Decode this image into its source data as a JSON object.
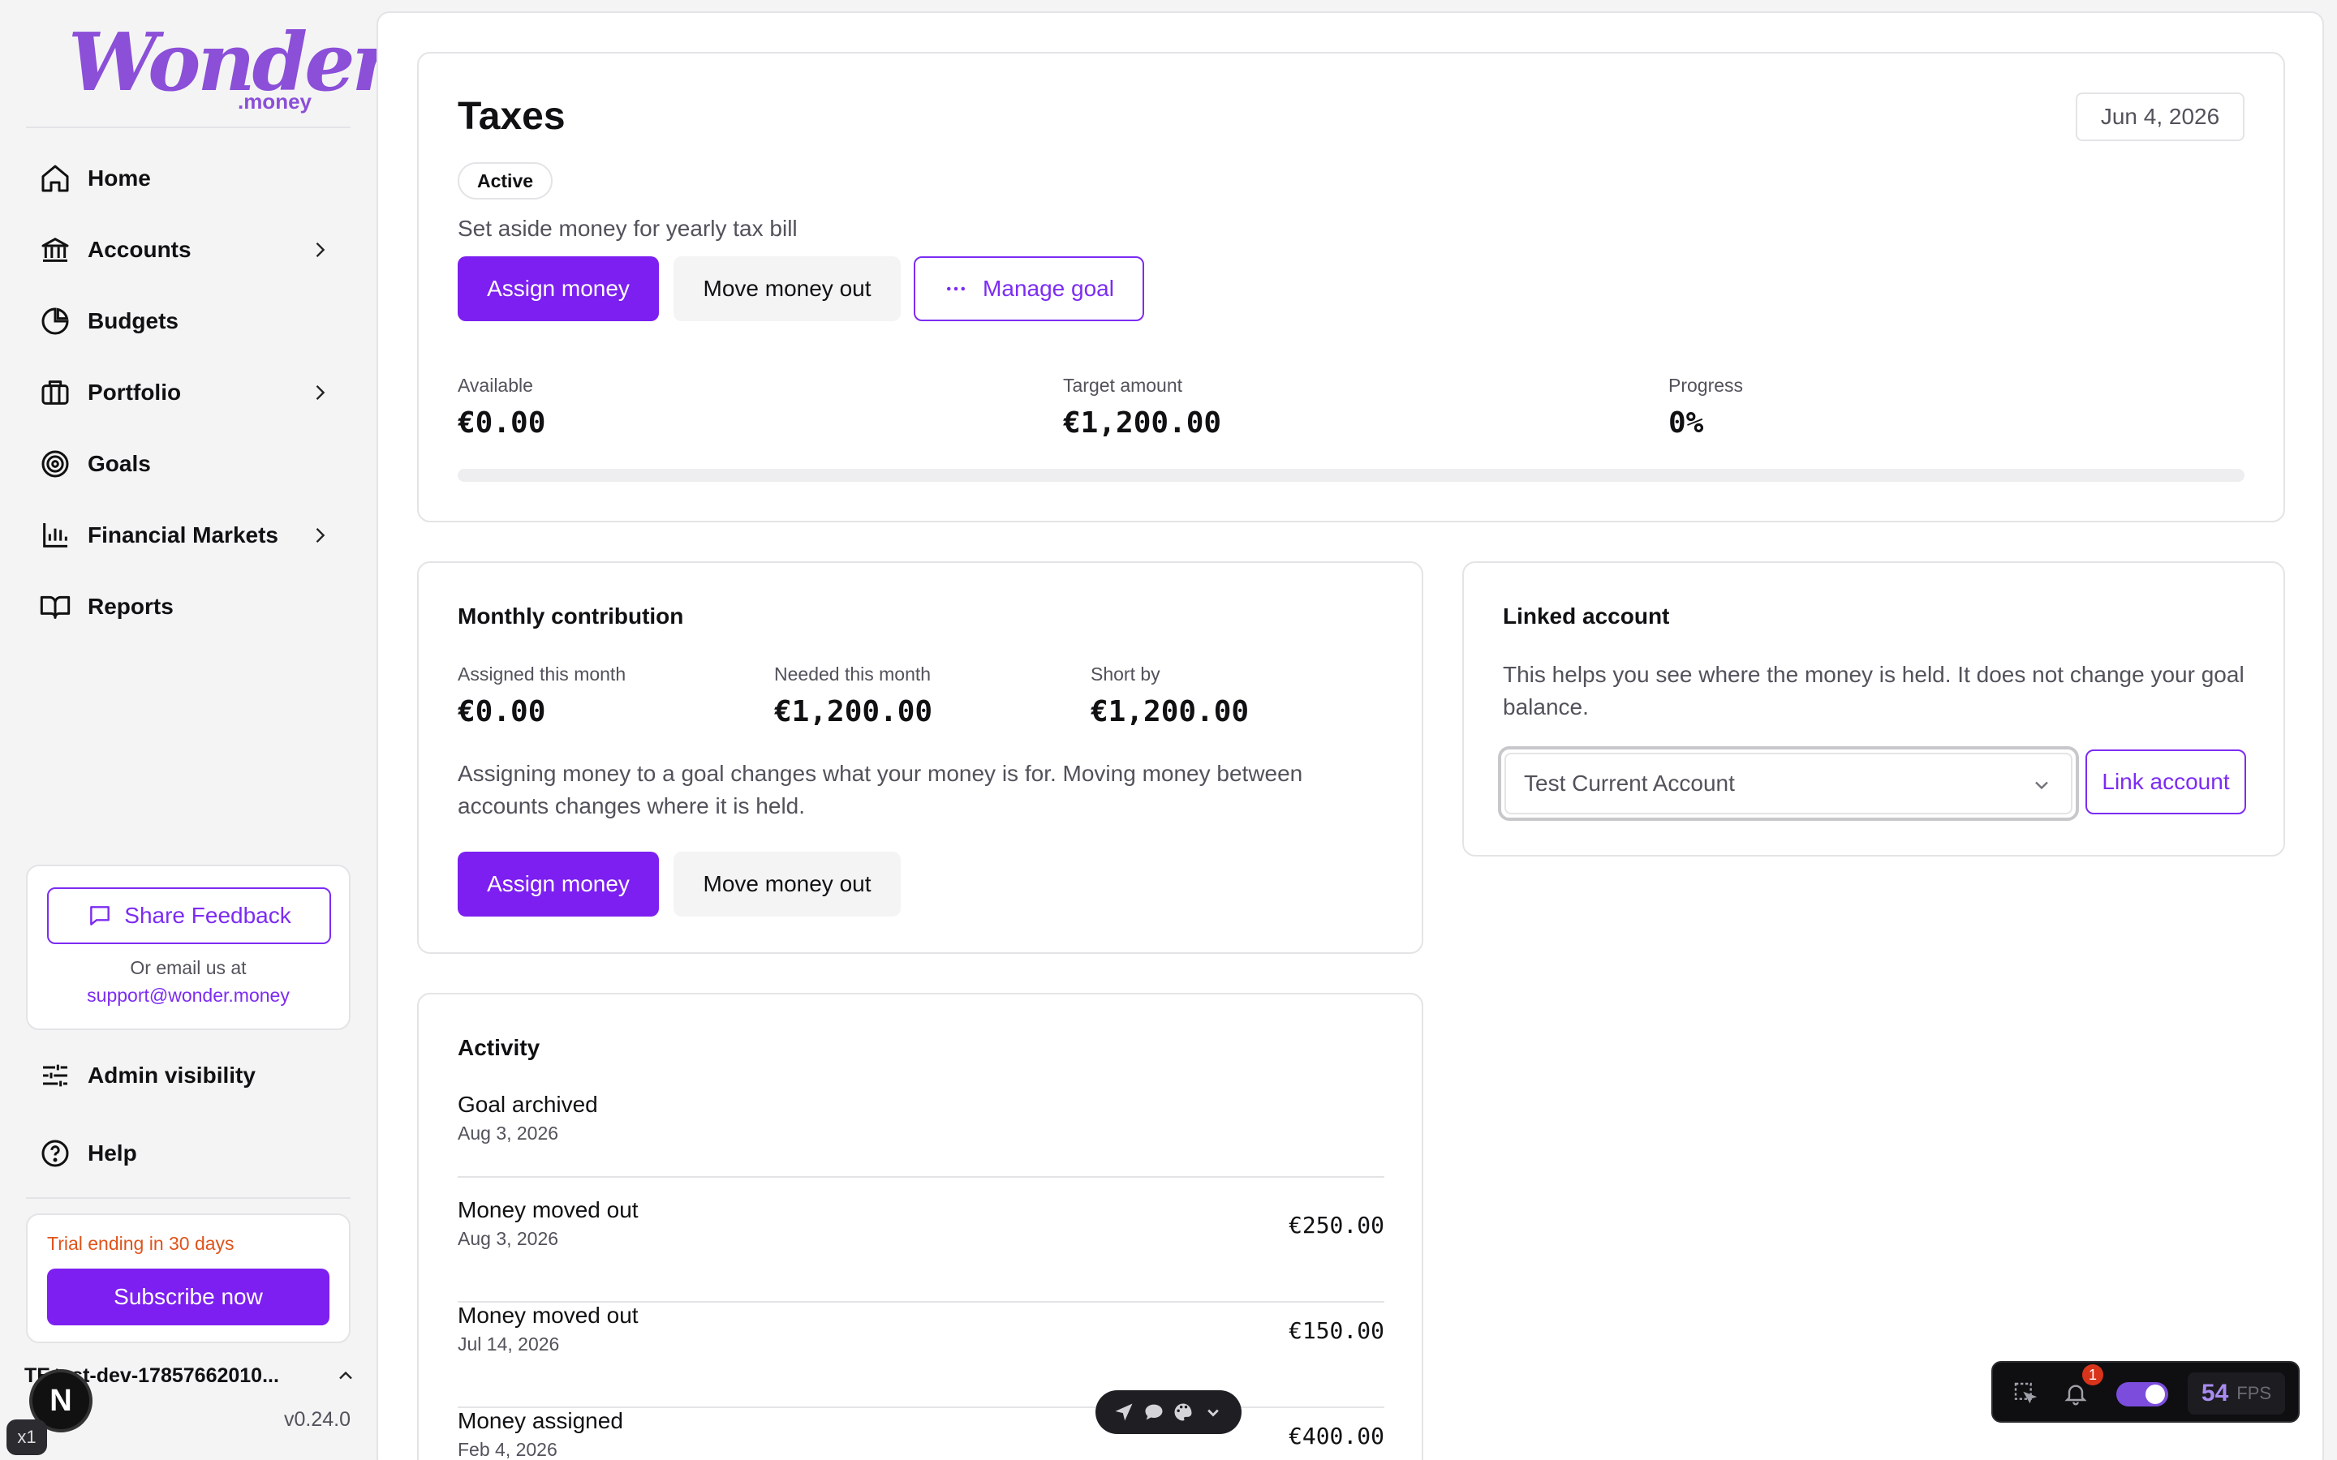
{
  "brand": {
    "name": "Wonder",
    "suffix": ".money",
    "color": "#8b4fd8"
  },
  "sidebar": {
    "nav": [
      {
        "label": "Home",
        "icon": "home-icon",
        "chevron": false
      },
      {
        "label": "Accounts",
        "icon": "bank-icon",
        "chevron": true
      },
      {
        "label": "Budgets",
        "icon": "pie-chart-icon",
        "chevron": false
      },
      {
        "label": "Portfolio",
        "icon": "briefcase-icon",
        "chevron": true
      },
      {
        "label": "Goals",
        "icon": "target-icon",
        "chevron": false
      },
      {
        "label": "Financial Markets",
        "icon": "bar-chart-icon",
        "chevron": true
      },
      {
        "label": "Reports",
        "icon": "book-icon",
        "chevron": false
      }
    ],
    "feedback": {
      "button_label": "Share Feedback",
      "or_text": "Or email us at",
      "email": "support@wonder.money"
    },
    "admin_label": "Admin visibility",
    "help_label": "Help",
    "trial": {
      "text": "Trial ending in 30 days",
      "subscribe_label": "Subscribe now"
    },
    "user": {
      "initials": "TE",
      "name": "test-dev-17857662010..."
    },
    "version": "v0.24.0"
  },
  "goal": {
    "title": "Taxes",
    "date": "Jun 4, 2026",
    "status": "Active",
    "description": "Set aside money for yearly tax bill",
    "actions": {
      "assign": "Assign money",
      "move_out": "Move money out",
      "manage": "Manage goal"
    },
    "stats": {
      "available_label": "Available",
      "available_value": "€0.00",
      "target_label": "Target amount",
      "target_value": "€1,200.00",
      "progress_label": "Progress",
      "progress_value": "0%",
      "progress_fraction": 0
    }
  },
  "monthly": {
    "title": "Monthly contribution",
    "assigned_label": "Assigned this month",
    "assigned_value": "€0.00",
    "needed_label": "Needed this month",
    "needed_value": "€1,200.00",
    "short_label": "Short by",
    "short_value": "€1,200.00",
    "explanation": "Assigning money to a goal changes what your money is for. Moving money between accounts changes where it is held.",
    "assign_label": "Assign money",
    "move_out_label": "Move money out"
  },
  "linked": {
    "title": "Linked account",
    "help": "This helps you see where the money is held. It does not change your goal balance.",
    "selected": "Test Current Account",
    "link_label": "Link account"
  },
  "activity": {
    "title": "Activity",
    "items": [
      {
        "name": "Goal archived",
        "date": "Aug 3, 2026",
        "amount": ""
      },
      {
        "name": "Money moved out",
        "date": "Aug 3, 2026",
        "amount": "€250.00"
      },
      {
        "name": "Money moved out",
        "date": "Jul 14, 2026",
        "amount": "€150.00"
      },
      {
        "name": "Money assigned",
        "date": "Feb 4, 2026",
        "amount": "€400.00"
      }
    ]
  },
  "devtools": {
    "notification_count": "1",
    "fps_value": "54",
    "fps_label": "FPS",
    "next_badge": "N",
    "zoom": "x1"
  },
  "colors": {
    "accent": "#7c1ff0",
    "trial_warning": "#e0531a"
  }
}
